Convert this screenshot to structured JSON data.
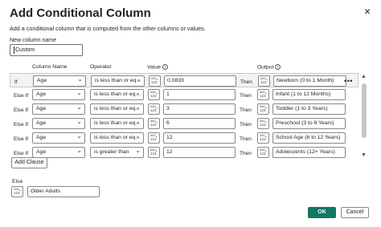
{
  "dialog": {
    "title": "Add Conditional Column",
    "close_glyph": "×",
    "description": "Add a conditional column that is computed from the other columns or values."
  },
  "new_column": {
    "label": "New column name",
    "value": "Custom"
  },
  "headers": {
    "column_name": "Column Name",
    "operator": "Operator",
    "value": "Value",
    "output": "Output",
    "info_glyph": "i"
  },
  "type_icon": {
    "top": "ABC",
    "bottom": "123"
  },
  "then_label": "Then",
  "more_glyph": "•••",
  "rows": [
    {
      "label": "If",
      "column": "Age",
      "operator": "is less than or eq...",
      "value": "0.0833",
      "output": "Newborn (0 to 1 Month)"
    },
    {
      "label": "Else If",
      "column": "Age",
      "operator": "is less than or eq...",
      "value": "1",
      "output": "Infant (1 to 12 Months)"
    },
    {
      "label": "Else If",
      "column": "Age",
      "operator": "is less than or eq...",
      "value": "3",
      "output": "Toddler (1 to 3 Years)"
    },
    {
      "label": "Else If",
      "column": "Age",
      "operator": "is less than or eq...",
      "value": "6",
      "output": "Preschool (3 to 6 Years)"
    },
    {
      "label": "Else If",
      "column": "Age",
      "operator": "is less than or eq...",
      "value": "12",
      "output": "School Age (6 to 12 Years)"
    },
    {
      "label": "Else If",
      "column": "Age",
      "operator": "is greater than",
      "value": "12",
      "output": "Adolescents (12+ Years)"
    }
  ],
  "add_clause_label": "Add Clause",
  "else": {
    "label": "Else",
    "value": "Older Adults"
  },
  "footer": {
    "ok_label": "OK",
    "cancel_label": "Cancel"
  },
  "colors": {
    "primary": "#117865",
    "text": "#252423",
    "border": "#8a8886"
  }
}
